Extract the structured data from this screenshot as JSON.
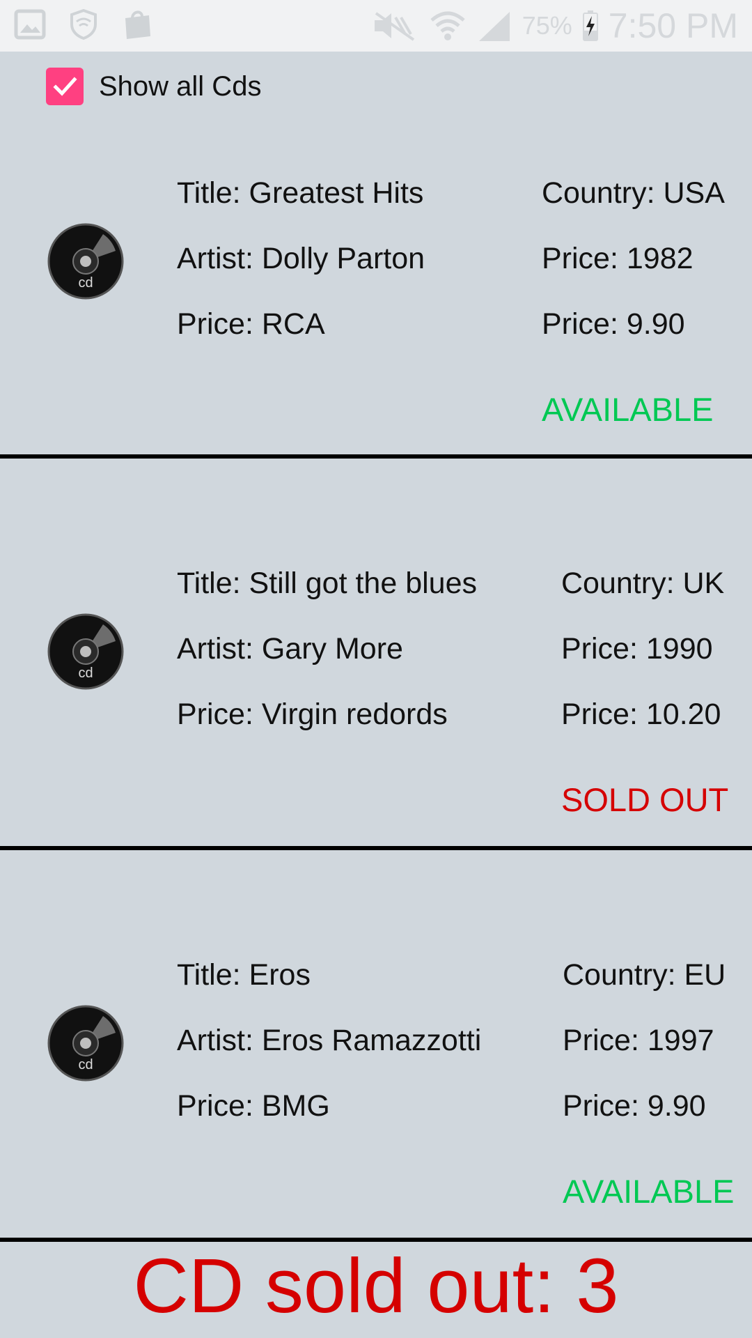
{
  "status_bar": {
    "battery": "75%",
    "time": "7:50 PM"
  },
  "show_all": {
    "label": "Show all Cds",
    "checked": true,
    "color": "#ff4081"
  },
  "cds": [
    {
      "title": "Title: Greatest Hits",
      "artist": "Artist: Dolly Parton",
      "company": "Price: RCA",
      "country": "Country: USA",
      "year": "Price: 1982",
      "price": "Price: 9.90",
      "status": "AVAILABLE",
      "status_color": "#00c853"
    },
    {
      "title": "Title: Still got the blues",
      "artist": "Artist: Gary More",
      "company": "Price: Virgin redords",
      "country": "Country: UK",
      "year": "Price: 1990",
      "price": "Price: 10.20",
      "status": "SOLD OUT",
      "status_color": "#d50000"
    },
    {
      "title": "Title: Eros",
      "artist": "Artist: Eros Ramazzotti",
      "company": "Price: BMG",
      "country": "Country: EU",
      "year": "Price: 1997",
      "price": "Price: 9.90",
      "status": "AVAILABLE",
      "status_color": "#00c853"
    }
  ],
  "footer": {
    "sold_out_text": "CD sold out: 3"
  }
}
